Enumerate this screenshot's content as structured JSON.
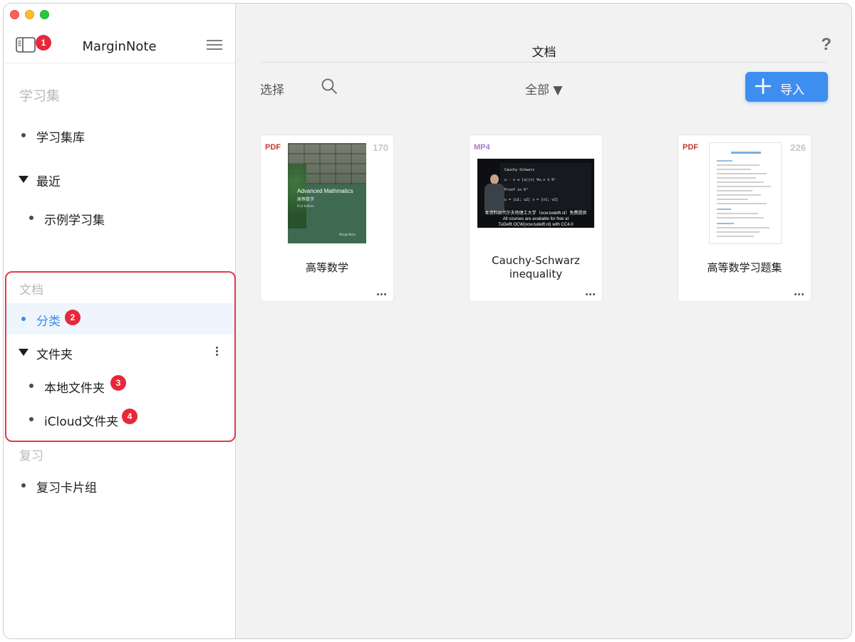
{
  "window": {
    "title": "MarginNote"
  },
  "sidebar": {
    "title": "MarginNote",
    "toggle_badge": "1",
    "sections": {
      "study_sets": {
        "title": "学习集",
        "library_label": "学习集库",
        "recent_label": "最近",
        "recent_items": [
          "示例学习集"
        ]
      },
      "documents": {
        "title": "文档",
        "category_label": "分类",
        "category_badge": "2",
        "folders_label": "文件夹",
        "local_folder_label": "本地文件夹",
        "local_folder_badge": "3",
        "icloud_folder_label": "iCloud文件夹",
        "icloud_folder_badge": "4"
      },
      "review": {
        "title": "复习",
        "deck_label": "复习卡片组"
      }
    }
  },
  "main": {
    "title": "文档",
    "help_label": "?",
    "select_label": "选择",
    "filter_label": "全部 ▼",
    "import_label": "导入",
    "documents": [
      {
        "type": "PDF",
        "pages": "170",
        "name": "高等数学",
        "cover_title": "Advanced Mathmatics",
        "cover_subtitle": "高等数学",
        "cover_edition": "First Edition",
        "cover_publisher": "MarginNote"
      },
      {
        "type": "MP4",
        "pages": "",
        "name": "Cauchy-Schwarz inequality",
        "video_board_lines": [
          "Cauchy-Schwarz",
          "u · v ≤ |u||v|  ∀u,v ∈ ℝⁿ",
          "Proof in ℝ²",
          "u = [u1; u2]   v = [v1; v2]"
        ],
        "video_caption_1": "本资料由代尔夫特理工大学（ocw.tudelft.nl）免费提供",
        "video_caption_2": "All courses are available for free at",
        "video_caption_3": "TuDelft OCW(ocw.tudelft.nl) with CC4.0"
      },
      {
        "type": "PDF",
        "pages": "226",
        "name": "高等数学习题集"
      }
    ]
  },
  "colors": {
    "accent": "#3e8ef0",
    "selected_text": "#3a8ee6",
    "badge": "#e8283a",
    "highlight_border": "#e03a4a",
    "pdf_tag": "#c0392b",
    "mp4_tag": "#a47bc4"
  },
  "icons": {
    "sidebar_toggle": "sidebar-toggle-icon",
    "menu": "hamburger-menu-icon",
    "search": "search-icon",
    "import": "plus-icon",
    "more": "ellipsis-icon",
    "folder_options": "vertical-ellipsis-icon"
  }
}
